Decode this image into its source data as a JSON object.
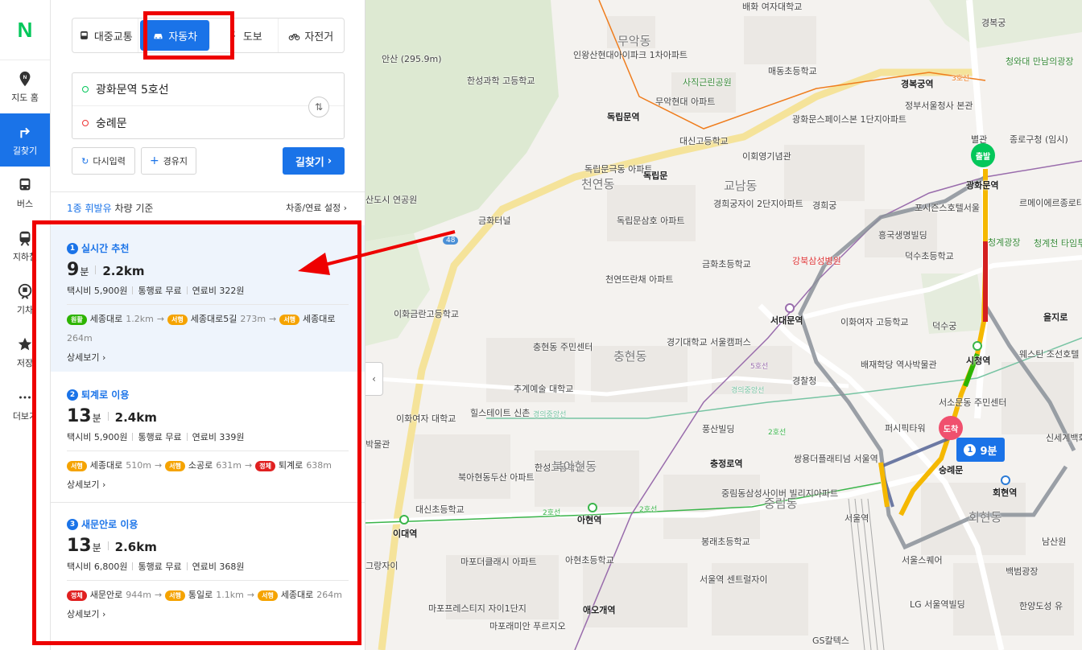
{
  "rail": {
    "logo": "N",
    "items": [
      {
        "label": "지도 홈",
        "icon": "map-home-icon"
      },
      {
        "label": "길찾기",
        "icon": "directions-icon",
        "active": true
      },
      {
        "label": "버스",
        "icon": "bus-icon"
      },
      {
        "label": "지하철",
        "icon": "subway-icon"
      },
      {
        "label": "기차",
        "icon": "train-icon"
      },
      {
        "label": "저장",
        "icon": "star-icon"
      },
      {
        "label": "더보기",
        "icon": "more-icon"
      }
    ]
  },
  "modes": [
    {
      "label": "대중교통",
      "icon": "bus-icon"
    },
    {
      "label": "자동차",
      "icon": "car-icon",
      "selected": true
    },
    {
      "label": "도보",
      "icon": "walk-icon"
    },
    {
      "label": "자전거",
      "icon": "bike-icon"
    }
  ],
  "route": {
    "origin": "광화문역 5호선",
    "destination": "숭례문"
  },
  "buttons": {
    "reset": "다시입력",
    "waypoint": "경유지",
    "search": "길찾기"
  },
  "basis": {
    "fuel_highlight": "1종 휘발유",
    "suffix": " 차량 기준",
    "settings": "차종/연료 설정"
  },
  "routes": [
    {
      "no": "1",
      "name": "실시간 추천",
      "minutes": "9",
      "unit": "분",
      "distance": "2.2km",
      "taxi": "택시비 5,900원",
      "toll": "통행료 무료",
      "fuel": "연료비 322원",
      "roads": [
        {
          "badge": "원활",
          "color": "#2db400",
          "name": "세종대로",
          "dist": "1.2km"
        },
        {
          "badge": "서행",
          "color": "#f5a300",
          "name": "세종대로5길",
          "dist": "273m"
        },
        {
          "badge": "서행",
          "color": "#f5a300",
          "name": "세종대로",
          "dist": "264m"
        }
      ],
      "detail": "상세보기"
    },
    {
      "no": "2",
      "name": "퇴계로 이용",
      "minutes": "13",
      "unit": "분",
      "distance": "2.4km",
      "taxi": "택시비 5,900원",
      "toll": "통행료 무료",
      "fuel": "연료비 339원",
      "roads": [
        {
          "badge": "서행",
          "color": "#f5a300",
          "name": "세종대로",
          "dist": "510m"
        },
        {
          "badge": "서행",
          "color": "#f5a300",
          "name": "소공로",
          "dist": "631m"
        },
        {
          "badge": "정체",
          "color": "#e02020",
          "name": "퇴계로",
          "dist": "638m"
        }
      ],
      "detail": "상세보기"
    },
    {
      "no": "3",
      "name": "새문안로 이용",
      "minutes": "13",
      "unit": "분",
      "distance": "2.6km",
      "taxi": "택시비 6,800원",
      "toll": "통행료 무료",
      "fuel": "연료비 368원",
      "roads": [
        {
          "badge": "정체",
          "color": "#e02020",
          "name": "새문안로",
          "dist": "944m"
        },
        {
          "badge": "서행",
          "color": "#f5a300",
          "name": "통일로",
          "dist": "1.1km"
        },
        {
          "badge": "서행",
          "color": "#f5a300",
          "name": "세종대로",
          "dist": "264m"
        }
      ],
      "detail": "상세보기"
    }
  ],
  "map": {
    "labels": [
      "배화 여자대학교",
      "경복궁",
      "무악동",
      "인왕산현대아이파크 1차아파트",
      "안산 (295.9m)",
      "한성과학 고등학교",
      "사직근린공원",
      "매동초등학교",
      "광화문역",
      "청와대 만남의광장",
      "경복궁역",
      "정부서울청사 본관",
      "독립문역",
      "무악현대 아파트",
      "광화문스페이스본 1단지아파트",
      "별관",
      "종로구청 (임시)",
      "대신고등학교",
      "이회영기념관",
      "독립문극동 아파트",
      "천연동",
      "독립문",
      "교남동",
      "경희궁자이 2단지아파트",
      "경희궁",
      "포시즌스호텔서울",
      "르메이에르종로타운",
      "산도시 연공원",
      "금화터널",
      "독립문삼호 아파트",
      "흥국생명빌딩",
      "청계광장",
      "청계천 타임투어",
      "금화초등학교",
      "강북삼성병원",
      "덕수초등학교",
      "천연뜨란채 아파트",
      "서대문역",
      "이화여자 고등학교",
      "이화금란고등학교",
      "덕수궁",
      "을지로",
      "충현동 주민센터",
      "충현동",
      "경기대학교 서울캠퍼스",
      "배재학당 역사박물관",
      "시청역",
      "웨스틴 조선호텔",
      "추계예술 대학교",
      "경찰청",
      "서소문동 주민센터",
      "힐스테이트 신촌",
      "이화여자 대학교",
      "풍산빌딩",
      "퍼시픽타워",
      "신세계백화점",
      "박물관",
      "충정로역",
      "쌍용더플래티넘 서울역",
      "숭례문",
      "한성고등학교",
      "북아현동두산 아파트",
      "북아현동",
      "중림동삼성사이버 빌리지아파트",
      "중림동",
      "회현역",
      "대신초등학교",
      "이대역",
      "아현역",
      "서울역",
      "회현동",
      "봉래초등학교",
      "마포더클래시 아파트",
      "아현초등학교",
      "서울역 센트럴자이",
      "서울스퀘어",
      "그랑자이",
      "백범광장",
      "남산원",
      "마포프레스티지 자이1단지",
      "애오개역",
      "LG 서울역빌딩",
      "한양도성 유",
      "마포래미안 푸르지오",
      "GS칼텍스"
    ],
    "start_pin": "출발",
    "end_pin": "도착",
    "eta_no": "1",
    "eta": "9분",
    "roads": [
      "3호선",
      "2호선",
      "2호선",
      "경의중앙선",
      "경의중앙선",
      "5호선",
      "2호선",
      "48"
    ]
  }
}
